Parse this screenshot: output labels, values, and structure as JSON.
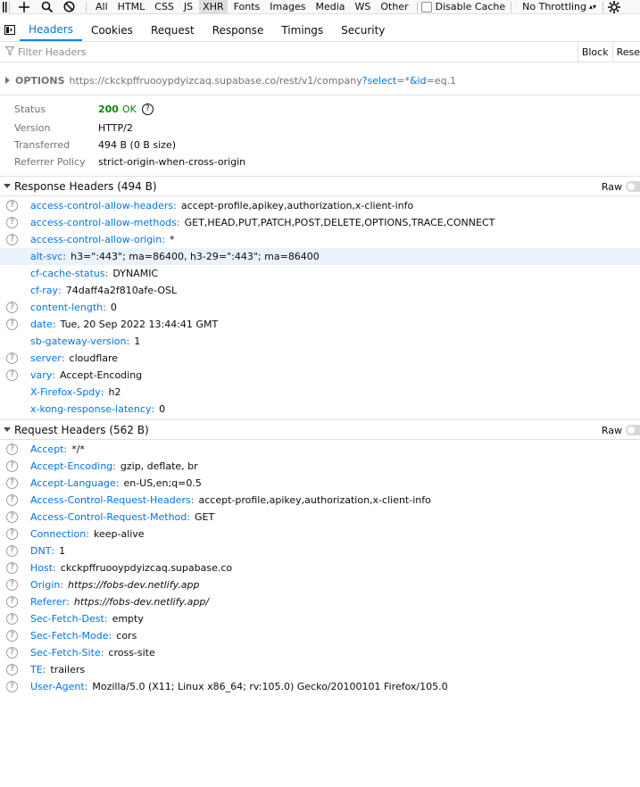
{
  "toolbar": {
    "filters": [
      "All",
      "HTML",
      "CSS",
      "JS",
      "XHR",
      "Fonts",
      "Images",
      "Media",
      "WS",
      "Other"
    ],
    "active_filter": "XHR",
    "disable_cache": "Disable Cache",
    "throttling": "No Throttling"
  },
  "tabs": [
    "Headers",
    "Cookies",
    "Request",
    "Response",
    "Timings",
    "Security"
  ],
  "active_tab": "Headers",
  "filter_bar": {
    "placeholder": "Filter Headers",
    "block": "Block",
    "resend": "Rese"
  },
  "summary": {
    "method": "OPTIONS",
    "url_base": "https://ckckpffruooypdyizcaq.supabase.co/rest/v1/company",
    "q_mark": "?",
    "p1_key": "select",
    "p1_val": "=*",
    "amp": "&",
    "p2_key": "id",
    "p2_val": "=eq.1"
  },
  "meta": {
    "status_label": "Status",
    "status_code": "200",
    "status_text": "OK",
    "version_label": "Version",
    "version": "HTTP/2",
    "transferred_label": "Transferred",
    "transferred": "494 B (0 B size)",
    "referrer_label": "Referrer Policy",
    "referrer": "strict-origin-when-cross-origin"
  },
  "response_headers": {
    "title": "Response Headers (494 B)",
    "raw": "Raw",
    "rows": [
      {
        "name": "access-control-allow-headers",
        "value": "accept-profile,apikey,authorization,x-client-info",
        "help": true
      },
      {
        "name": "access-control-allow-methods",
        "value": "GET,HEAD,PUT,PATCH,POST,DELETE,OPTIONS,TRACE,CONNECT",
        "help": true
      },
      {
        "name": "access-control-allow-origin",
        "value": "*",
        "help": true
      },
      {
        "name": "alt-svc",
        "value": "h3=\":443\"; ma=86400, h3-29=\":443\"; ma=86400",
        "help": false,
        "highlight": true
      },
      {
        "name": "cf-cache-status",
        "value": "DYNAMIC",
        "help": false
      },
      {
        "name": "cf-ray",
        "value": "74daff4a2f810afe-OSL",
        "help": false
      },
      {
        "name": "content-length",
        "value": "0",
        "help": true
      },
      {
        "name": "date",
        "value": "Tue, 20 Sep 2022 13:44:41 GMT",
        "help": true
      },
      {
        "name": "sb-gateway-version",
        "value": "1",
        "help": false
      },
      {
        "name": "server",
        "value": "cloudflare",
        "help": true
      },
      {
        "name": "vary",
        "value": "Accept-Encoding",
        "help": true
      },
      {
        "name": "X-Firefox-Spdy",
        "value": "h2",
        "help": false
      },
      {
        "name": "x-kong-response-latency",
        "value": "0",
        "help": false
      }
    ]
  },
  "request_headers": {
    "title": "Request Headers (562 B)",
    "raw": "Raw",
    "rows": [
      {
        "name": "Accept",
        "value": "*/*",
        "help": true
      },
      {
        "name": "Accept-Encoding",
        "value": "gzip, deflate, br",
        "help": true
      },
      {
        "name": "Accept-Language",
        "value": "en-US,en;q=0.5",
        "help": true
      },
      {
        "name": "Access-Control-Request-Headers",
        "value": "accept-profile,apikey,authorization,x-client-info",
        "help": true
      },
      {
        "name": "Access-Control-Request-Method",
        "value": "GET",
        "help": true
      },
      {
        "name": "Connection",
        "value": "keep-alive",
        "help": true
      },
      {
        "name": "DNT",
        "value": "1",
        "help": true
      },
      {
        "name": "Host",
        "value": "ckckpffruooypdyizcaq.supabase.co",
        "help": true
      },
      {
        "name": "Origin",
        "value": "https://fobs-dev.netlify.app",
        "help": true,
        "italic": true
      },
      {
        "name": "Referer",
        "value": "https://fobs-dev.netlify.app/",
        "help": true,
        "italic": true
      },
      {
        "name": "Sec-Fetch-Dest",
        "value": "empty",
        "help": true
      },
      {
        "name": "Sec-Fetch-Mode",
        "value": "cors",
        "help": true
      },
      {
        "name": "Sec-Fetch-Site",
        "value": "cross-site",
        "help": true
      },
      {
        "name": "TE",
        "value": "trailers",
        "help": true
      },
      {
        "name": "User-Agent",
        "value": "Mozilla/5.0 (X11; Linux x86_64; rv:105.0) Gecko/20100101 Firefox/105.0",
        "help": true
      }
    ]
  },
  "icons": {
    "add": "plus-icon",
    "search": "search-icon",
    "block": "block-icon",
    "settings": "gear-icon",
    "panel": "panel-icon",
    "filter": "filter-icon",
    "help": "help-icon"
  }
}
